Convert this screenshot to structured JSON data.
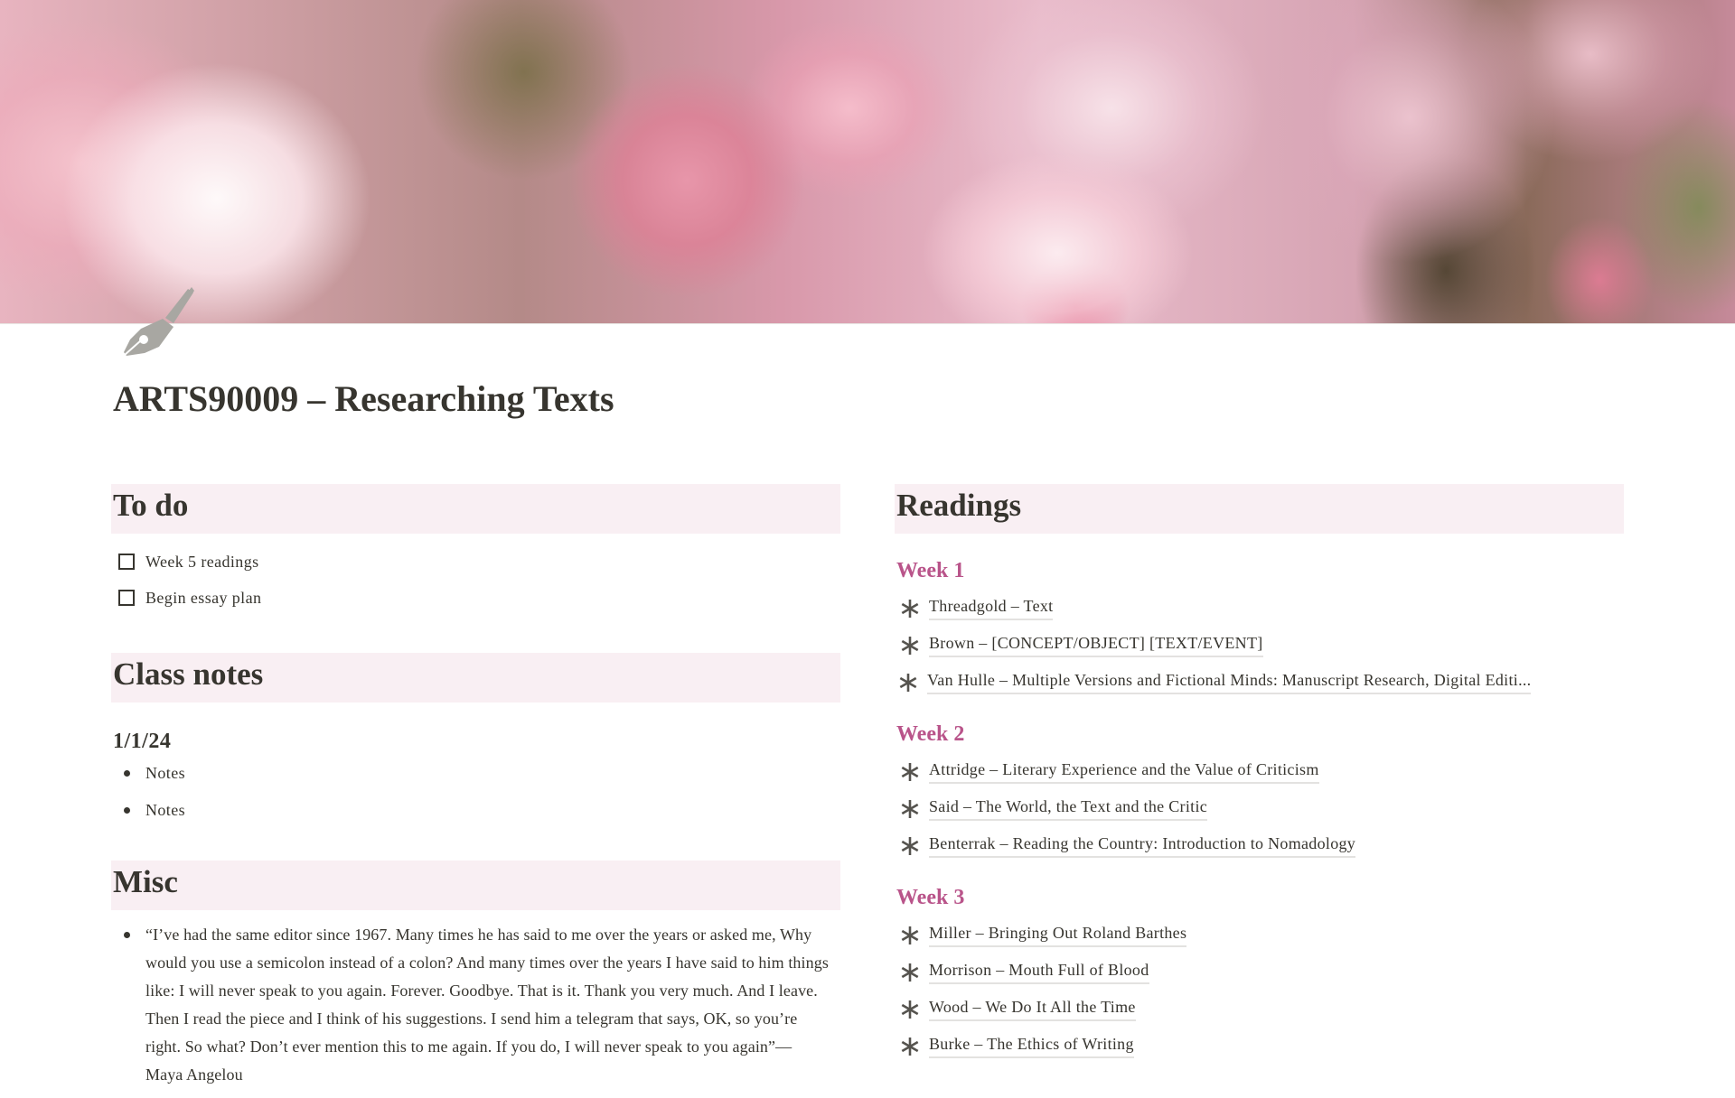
{
  "page": {
    "title": "ARTS90009 – Researching Texts",
    "icon": "fountain-pen-icon",
    "cover": "pink-roses-photo"
  },
  "colors": {
    "section_header_bg": "#f9eff3",
    "week_heading": "#b9548a",
    "text": "#37352f",
    "icon_gray": "#a8a7a2"
  },
  "todo": {
    "heading": "To do",
    "items": [
      {
        "label": "Week 5 readings",
        "checked": false
      },
      {
        "label": "Begin essay plan",
        "checked": false
      }
    ]
  },
  "class_notes": {
    "heading": "Class notes",
    "entries": [
      {
        "date": "1/1/24",
        "notes": [
          "Notes",
          "Notes"
        ]
      }
    ]
  },
  "misc": {
    "heading": "Misc",
    "items": [
      "“I’ve had the same editor since 1967. Many times he has said to me over the years or asked me, Why would you use a semicolon instead of a colon? And many times over the years I have said to him things like: I will never speak to you again. Forever. Goodbye. That is it. Thank you very much. And I leave. Then I read the piece and I think of his suggestions. I send him a telegram that says, OK, so you’re right. So what? Don’t ever mention this to me again. If you do, I will never speak to you again”— Maya Angelou"
    ]
  },
  "readings": {
    "heading": "Readings",
    "item_icon": "asterisk-icon",
    "weeks": [
      {
        "label": "Week 1",
        "items": [
          "Threadgold – Text",
          "Brown – [CONCEPT/OBJECT] [TEXT/EVENT]",
          "Van Hulle – Multiple Versions and Fictional Minds: Manuscript Research, Digital Editi..."
        ]
      },
      {
        "label": "Week 2",
        "items": [
          "Attridge – Literary Experience and the Value of Criticism",
          "Said – The World, the Text and the Critic",
          "Benterrak – Reading the Country: Introduction to Nomadology"
        ]
      },
      {
        "label": "Week 3",
        "items": [
          "Miller – Bringing Out Roland Barthes",
          "Morrison – Mouth Full of Blood",
          "Wood – We Do It All the Time",
          "Burke – The Ethics of Writing"
        ]
      }
    ]
  }
}
